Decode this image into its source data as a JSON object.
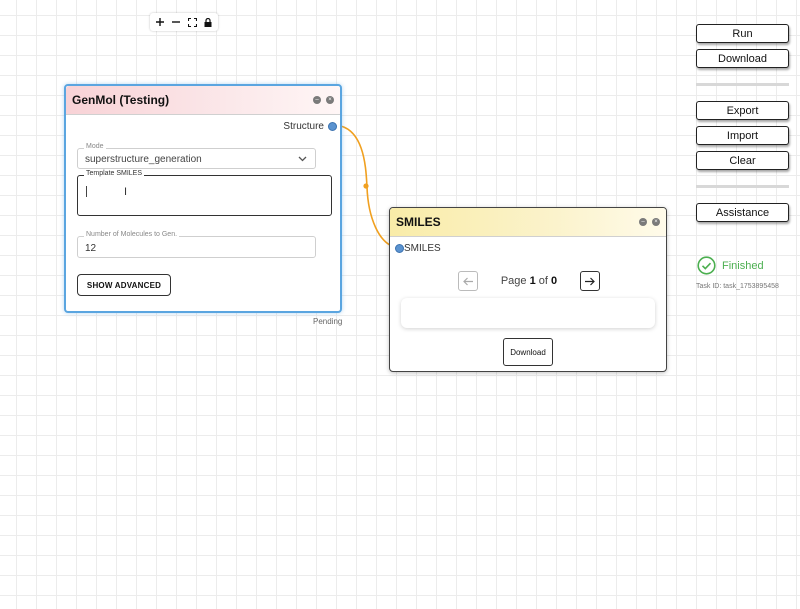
{
  "zoom_toolbar": {
    "zoom_in": "+",
    "zoom_out": "−"
  },
  "genmol_node": {
    "title": "GenMol (Testing)",
    "output_port": "Structure",
    "mode": {
      "label": "Mode",
      "value": "superstructure_generation"
    },
    "template": {
      "label": "Template SMILES",
      "value": ""
    },
    "num_molecules": {
      "label": "Number of Molecules to Gen.",
      "value": "12"
    },
    "advanced_button": "SHOW ADVANCED",
    "status": "Pending"
  },
  "smiles_node": {
    "title": "SMILES",
    "input_port": "SMILES",
    "pager": {
      "prefix": "Page",
      "current": "1",
      "sep": "of",
      "total": "0"
    },
    "download_button": "Download"
  },
  "side_panel": {
    "run": "Run",
    "download": "Download",
    "export": "Export",
    "import": "Import",
    "clear": "Clear",
    "assistance": "Assistance",
    "status": "Finished",
    "task_id": "Task ID: task_1753895458",
    "status_color": "#4caf50"
  },
  "colors": {
    "wire": "#f0a020",
    "selected_border": "#5aa5e0",
    "port": "#5b93d0"
  }
}
